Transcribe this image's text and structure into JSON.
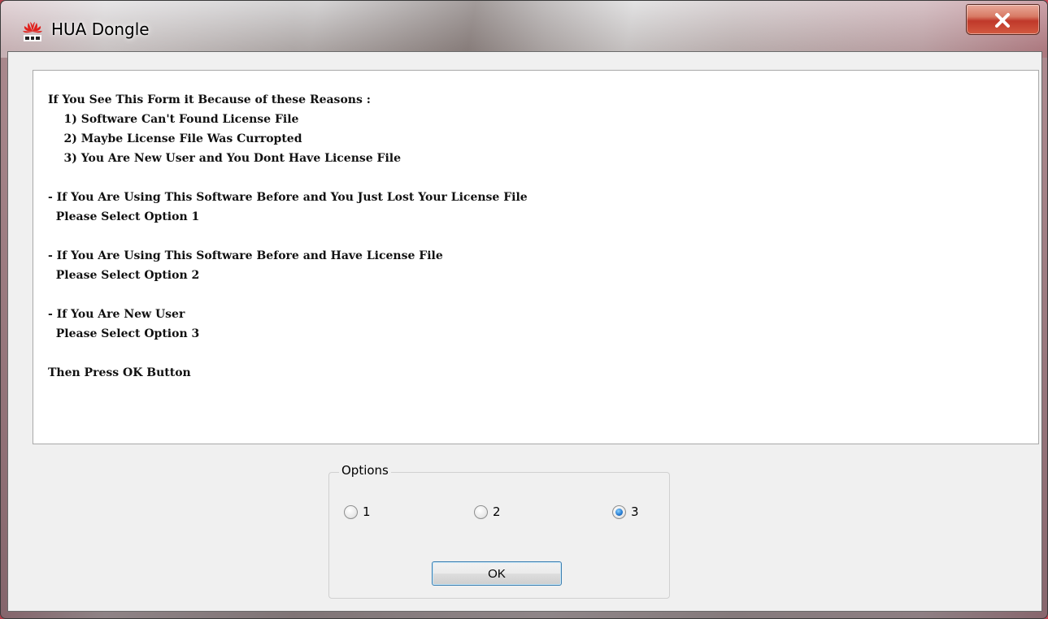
{
  "window": {
    "title": "HUA Dongle"
  },
  "info": {
    "text": "If You See This Form it Because of these Reasons :\n    1) Software Can't Found License File\n    2) Maybe License File Was Curropted\n    3) You Are New User and You Dont Have License File\n\n- If You Are Using This Software Before and You Just Lost Your License File\n  Please Select Option 1\n\n- If You Are Using This Software Before and Have License File\n  Please Select Option 2\n\n- If You Are New User\n  Please Select Option 3\n\nThen Press OK Button"
  },
  "options": {
    "legend": "Options",
    "items": [
      {
        "label": "1",
        "checked": false
      },
      {
        "label": "2",
        "checked": false
      },
      {
        "label": "3",
        "checked": true
      }
    ],
    "ok_label": "OK"
  },
  "icons": {
    "app": "huawei-logo-icon",
    "close": "close-icon"
  },
  "colors": {
    "close_button": "#c0382a",
    "radio_selected": "#2a7fd4",
    "ok_border": "#3c7fb1"
  }
}
